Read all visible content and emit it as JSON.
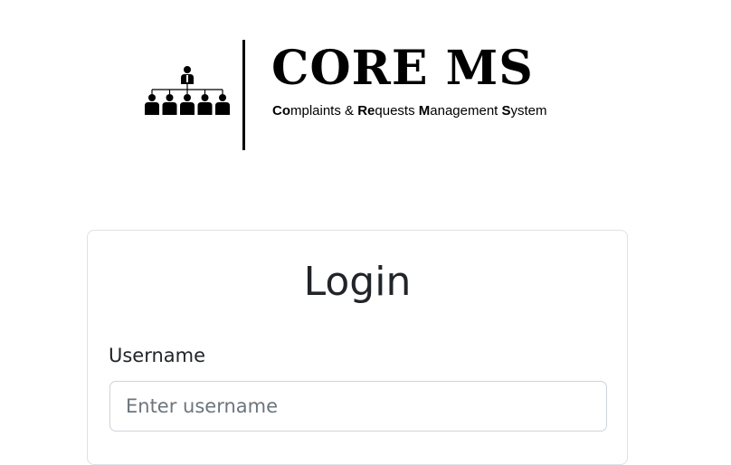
{
  "logo": {
    "title": "CORE MS",
    "subtitle_parts": [
      {
        "text": "Co",
        "bold": true
      },
      {
        "text": "mplaints & ",
        "bold": false
      },
      {
        "text": "Re",
        "bold": true
      },
      {
        "text": "quests ",
        "bold": false
      },
      {
        "text": "M",
        "bold": true
      },
      {
        "text": "anagement ",
        "bold": false
      },
      {
        "text": "S",
        "bold": true
      },
      {
        "text": "ystem",
        "bold": false
      }
    ],
    "icon": "org-chart-icon"
  },
  "login": {
    "title": "Login",
    "username_label": "Username",
    "username_placeholder": "Enter username",
    "username_value": ""
  },
  "colors": {
    "text": "#212529",
    "border": "#dee2e6",
    "input_border": "#ced4da",
    "placeholder": "#6c757d"
  }
}
